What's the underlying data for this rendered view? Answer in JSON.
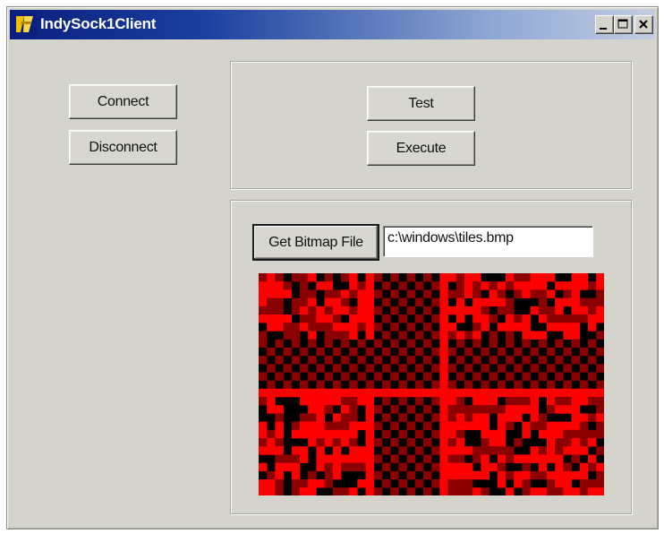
{
  "window": {
    "title": "IndySock1Client",
    "controls": [
      "minimize",
      "maximize",
      "close"
    ]
  },
  "connection": {
    "connect_label": "Connect",
    "disconnect_label": "Disconnect"
  },
  "actions": {
    "test_label": "Test",
    "execute_label": "Execute"
  },
  "bitmap_panel": {
    "get_bitmap_label": "Get Bitmap File",
    "file_path": "c:\\windows\\tiles.bmp",
    "image_description_icon": "tiles-bitmap-image"
  },
  "colors": {
    "bitmap_red": "#ff0000",
    "bitmap_dark_red": "#8b0000",
    "bitmap_black": "#000000"
  }
}
